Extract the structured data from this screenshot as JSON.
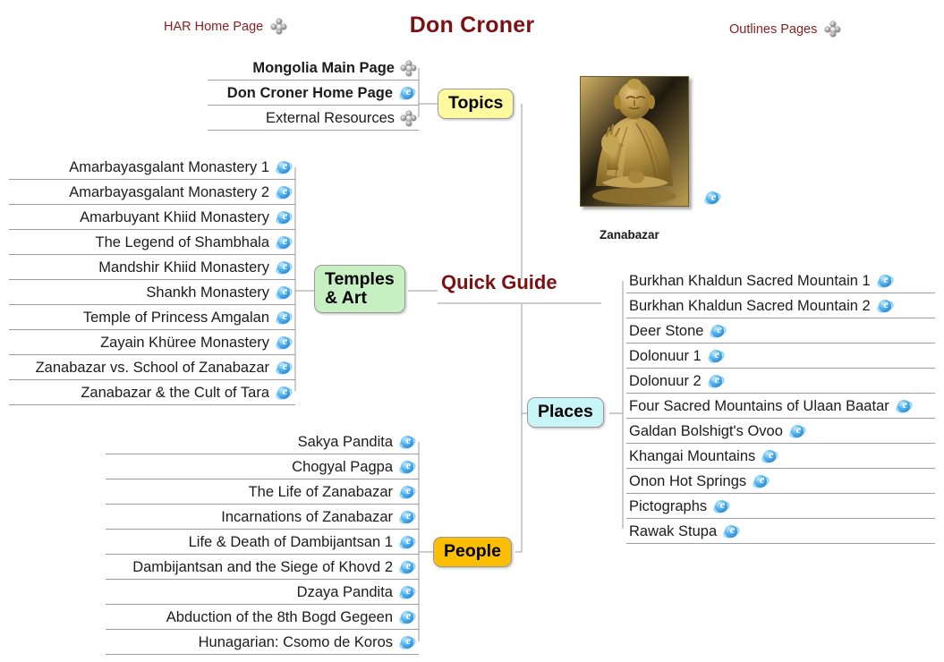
{
  "header": {
    "title": "Don Croner",
    "left_link": "HAR Home Page",
    "right_link": "Outlines Pages",
    "move_icon": "move-icon"
  },
  "central": {
    "label": "Quick Guide"
  },
  "figure": {
    "caption": "Zanabazar",
    "alt": "gilt bronze seated statue of Zanabazar",
    "link_icon": "ie-icon"
  },
  "branches": [
    {
      "id": "topics",
      "label": "Topics",
      "color": "#FFF9A0",
      "items": [
        {
          "label": "Mongolia Main Page",
          "icon": "move-icon",
          "bold": true
        },
        {
          "label": "Don Croner Home Page",
          "icon": "ie-icon",
          "bold": true
        },
        {
          "label": "External Resources",
          "icon": "move-icon",
          "bold": false
        }
      ]
    },
    {
      "id": "temples",
      "label": "Temples\n& Art",
      "color": "#C6F0C2",
      "items": [
        {
          "label": "Amarbayasgalant Monastery 1",
          "icon": "ie-icon"
        },
        {
          "label": "Amarbayasgalant Monastery 2",
          "icon": "ie-icon"
        },
        {
          "label": "Amarbuyant Khiid Monastery",
          "icon": "ie-icon"
        },
        {
          "label": "The Legend of Shambhala",
          "icon": "ie-icon"
        },
        {
          "label": "Mandshir Khiid Monastery",
          "icon": "ie-icon"
        },
        {
          "label": "Shankh Monastery",
          "icon": "ie-icon"
        },
        {
          "label": "Temple of Princess Amgalan",
          "icon": "ie-icon"
        },
        {
          "label": "Zayain Khüree Monastery",
          "icon": "ie-icon"
        },
        {
          "label": "Zanabazar vs. School of Zanabazar",
          "icon": "ie-icon"
        },
        {
          "label": "Zanabazar & the Cult of Tara",
          "icon": "ie-icon"
        }
      ]
    },
    {
      "id": "places",
      "label": "Places",
      "color": "#C8F5F7",
      "items": [
        {
          "label": "Burkhan Khaldun Sacred Mountain 1",
          "icon": "ie-icon"
        },
        {
          "label": "Burkhan Khaldun Sacred Mountain 2",
          "icon": "ie-icon"
        },
        {
          "label": "Deer Stone",
          "icon": "ie-icon"
        },
        {
          "label": "Dolonuur 1",
          "icon": "ie-icon"
        },
        {
          "label": "Dolonuur 2",
          "icon": "ie-icon"
        },
        {
          "label": "Four Sacred Mountains of Ulaan Baatar",
          "icon": "ie-icon"
        },
        {
          "label": "Galdan Bolshigt's Ovoo",
          "icon": "ie-icon"
        },
        {
          "label": "Khangai Mountains",
          "icon": "ie-icon"
        },
        {
          "label": "Onon Hot Springs",
          "icon": "ie-icon"
        },
        {
          "label": "Pictographs",
          "icon": "ie-icon"
        },
        {
          "label": "Rawak Stupa",
          "icon": "ie-icon"
        }
      ]
    },
    {
      "id": "people",
      "label": "People",
      "color": "#FBBE02",
      "items": [
        {
          "label": "Sakya Pandita",
          "icon": "ie-icon"
        },
        {
          "label": "Chogyal Pagpa",
          "icon": "ie-icon"
        },
        {
          "label": "The Life of Zanabazar",
          "icon": "ie-icon"
        },
        {
          "label": "Incarnations of Zanabazar",
          "icon": "ie-icon"
        },
        {
          "label": "Life & Death of Dambijantsan 1",
          "icon": "ie-icon"
        },
        {
          "label": "Dambijantsan and the Siege of Khovd 2",
          "icon": "ie-icon"
        },
        {
          "label": "Dzaya Pandita",
          "icon": "ie-icon"
        },
        {
          "label": "Abduction of the 8th Bogd Gegeen",
          "icon": "ie-icon"
        },
        {
          "label": "Hunagarian: Csomo de Koros",
          "icon": "ie-icon"
        }
      ]
    }
  ]
}
